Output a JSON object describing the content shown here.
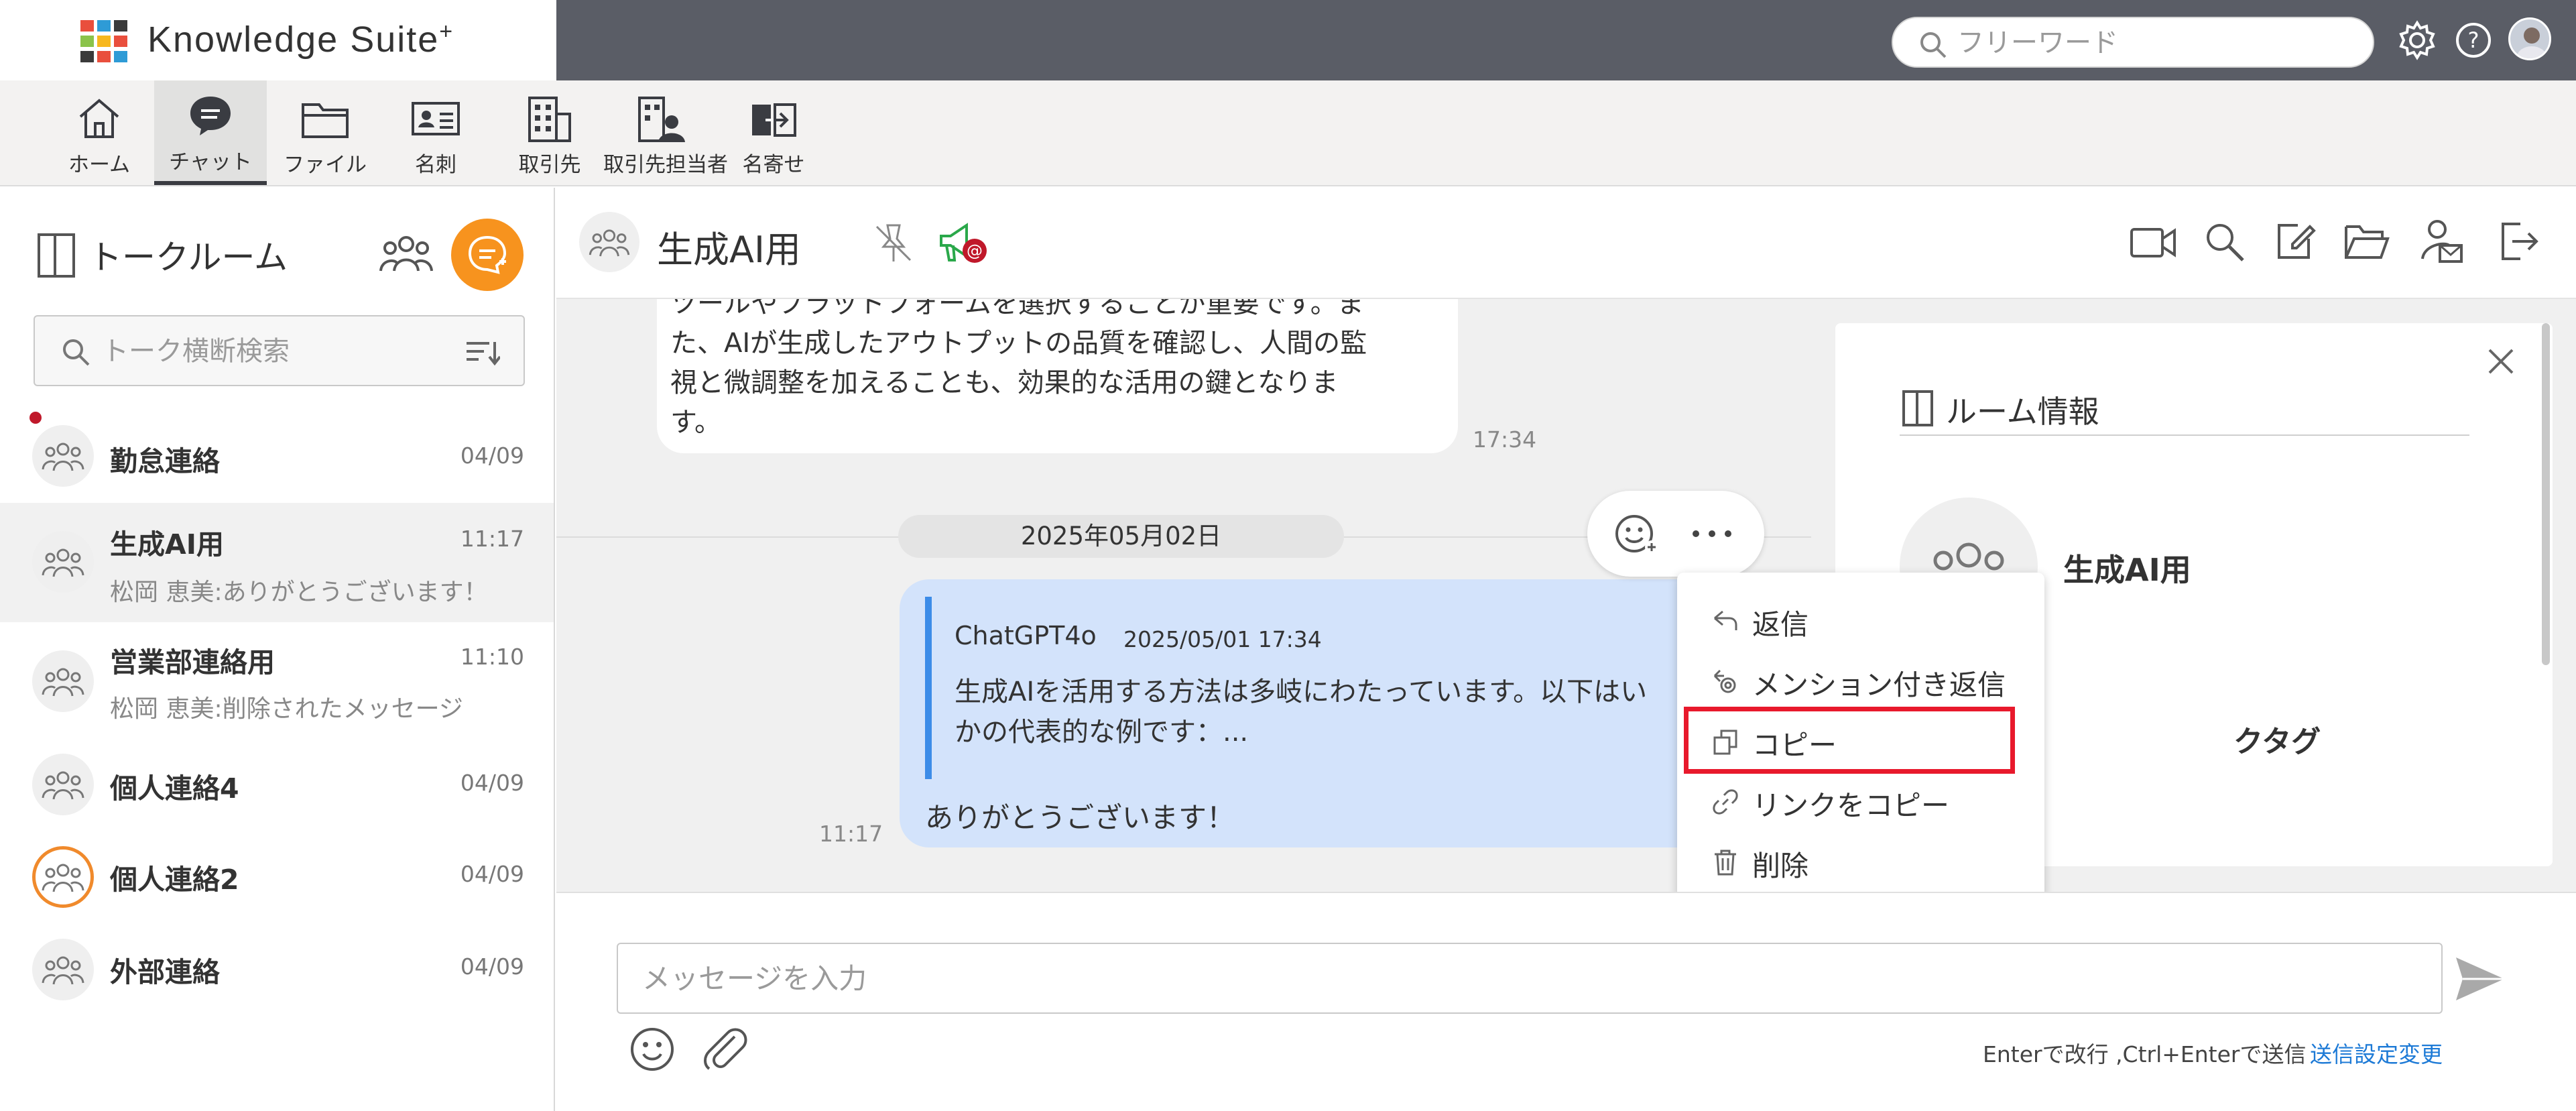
{
  "app": {
    "name": "Knowledge Suite",
    "name_sup": "+"
  },
  "header": {
    "search_placeholder": "フリーワード"
  },
  "nav": {
    "items": [
      {
        "label": "ホーム",
        "icon": "home-icon"
      },
      {
        "label": "チャット",
        "icon": "chat-icon",
        "active": true
      },
      {
        "label": "ファイル",
        "icon": "folder-icon"
      },
      {
        "label": "名刺",
        "icon": "business-card-icon"
      },
      {
        "label": "取引先",
        "icon": "building-icon"
      },
      {
        "label": "取引先担当者",
        "icon": "contact-person-icon"
      },
      {
        "label": "名寄せ",
        "icon": "merge-icon"
      }
    ]
  },
  "sidebar": {
    "title": "トークルーム",
    "search_placeholder": "トーク横断検索",
    "rooms": [
      {
        "name": "勤怠連絡",
        "time": "04/09",
        "preview": "",
        "unread": true
      },
      {
        "name": "生成AI用",
        "time": "11:17",
        "preview": "松岡 恵美:ありがとうございます！",
        "active": true
      },
      {
        "name": "営業部連絡用",
        "time": "11:10",
        "preview": "松岡 恵美:削除されたメッセージ"
      },
      {
        "name": "個人連絡4",
        "time": "04/09",
        "preview": ""
      },
      {
        "name": "個人連絡2",
        "time": "04/09",
        "preview": ""
      },
      {
        "name": "外部連絡",
        "time": "04/09",
        "preview": ""
      }
    ]
  },
  "chat": {
    "title": "生成AI用",
    "previous_message": {
      "lines": [
        "ツールやプラットフォームを選択することが重要です。ま",
        "た、AIが生成したアウトプットの品質を確認し、人間の監",
        "視と微調整を加えることも、効果的な活用の鍵となりま",
        "す。"
      ],
      "time": "17:34"
    },
    "date_separator": "2025年05月02日",
    "message": {
      "quote_sender": "ChatGPT4o",
      "quote_date": "2025/05/01 17:34",
      "quote_lines": [
        "生成AIを活用する方法は多岐にわたっています。以下はい",
        "かの代表的な例です：..."
      ],
      "text": "ありがとうございます！",
      "time": "11:17"
    }
  },
  "context_menu": {
    "items": [
      {
        "label": "返信",
        "icon": "reply-icon"
      },
      {
        "label": "メンション付き返信",
        "icon": "mention-reply-icon"
      },
      {
        "label": "コピー",
        "icon": "copy-icon",
        "highlighted": true
      },
      {
        "label": "リンクをコピー",
        "icon": "link-icon"
      },
      {
        "label": "削除",
        "icon": "trash-icon"
      }
    ]
  },
  "room_info": {
    "title": "ルーム情報",
    "room_name": "生成AI用",
    "tag_label": "クタグ"
  },
  "composer": {
    "placeholder": "メッセージを入力",
    "hint": "Enterで改行 ,Ctrl+Enterで送信",
    "settings_link": "送信設定変更"
  },
  "colors": {
    "accent_orange": "#f7931e",
    "highlight_red": "#e8192c",
    "bubble_blue": "#d3e3fb",
    "link_blue": "#1d7ad6"
  }
}
